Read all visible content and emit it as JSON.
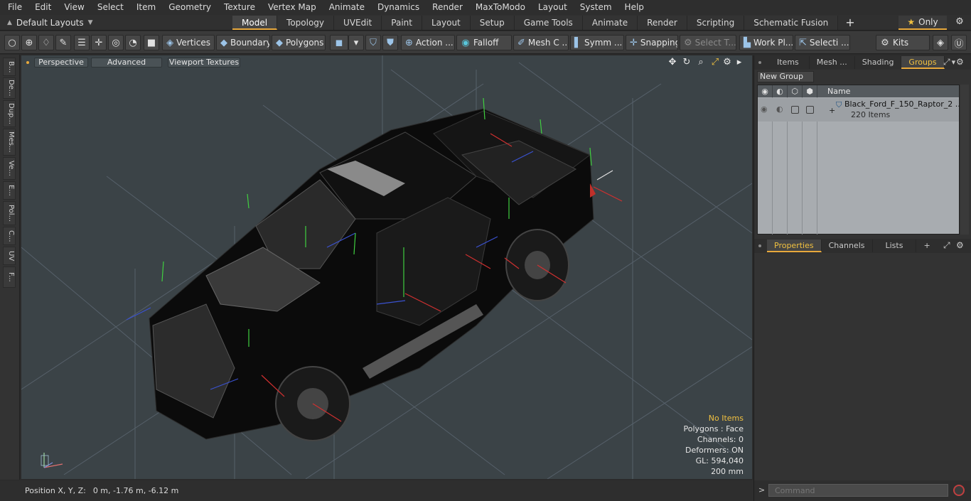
{
  "menu": [
    "File",
    "Edit",
    "View",
    "Select",
    "Item",
    "Geometry",
    "Texture",
    "Vertex Map",
    "Animate",
    "Dynamics",
    "Render",
    "MaxToModo",
    "Layout",
    "System",
    "Help"
  ],
  "layout_select": "Default Layouts",
  "tabs": [
    "Model",
    "Topology",
    "UVEdit",
    "Paint",
    "Layout",
    "Setup",
    "Game Tools",
    "Animate",
    "Render",
    "Scripting",
    "Schematic Fusion"
  ],
  "active_tab": "Model",
  "only_label": "Only",
  "toolbar": {
    "vertices": "Vertices",
    "boundary": "Boundary",
    "polygons": "Polygons",
    "action": "Action ...",
    "falloff": "Falloff",
    "mesh": "Mesh C ...",
    "symm": "Symm ...",
    "snapping": "Snapping",
    "select_t": "Select T...",
    "work_pl": "Work Pl...",
    "selecti": "Selecti ...",
    "kits": "Kits"
  },
  "left_tabs": [
    "B...",
    "De...",
    "Dup...",
    "Mes...",
    "Ve...",
    "E...",
    "Pol...",
    "C...",
    "UV",
    "F..."
  ],
  "viewport": {
    "perspective": "Perspective",
    "advanced": "Advanced",
    "textures": "Viewport Textures",
    "stats": {
      "items": "No Items",
      "polygons": "Polygons : Face",
      "channels": "Channels: 0",
      "deformers": "Deformers: ON",
      "gl": "GL: 594,040",
      "size": "200 mm"
    }
  },
  "status": {
    "label": "Position X, Y, Z:",
    "value": "0 m, -1.76 m, -6.12 m"
  },
  "top_panel_tabs": [
    "Items",
    "Mesh ...",
    "Shading",
    "Groups"
  ],
  "active_top_panel": "Groups",
  "new_group": "New Group",
  "groups_header": "Name",
  "group_row": {
    "name": "Black_Ford_F_150_Raptor_2 ...",
    "count": "220 Items"
  },
  "bottom_panel_tabs": [
    "Properties",
    "Channels",
    "Lists"
  ],
  "command_placeholder": "Command",
  "colors": {
    "accent": "#e8a93c",
    "viewport_bg": "#3b4347",
    "list_bg": "#a8acb0"
  }
}
